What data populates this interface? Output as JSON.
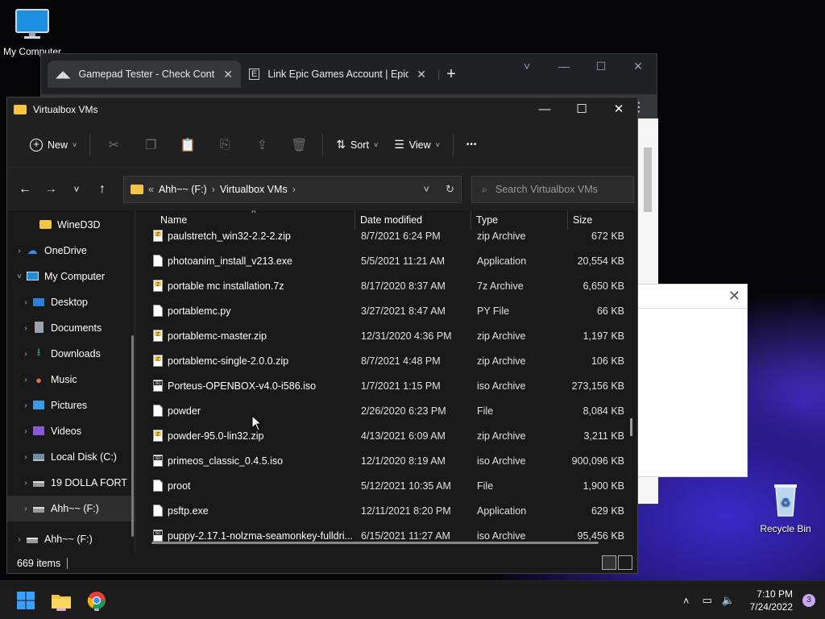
{
  "desktop": {
    "icons": [
      {
        "label": "My Computer",
        "icon": "monitor-icon"
      },
      {
        "label": "Recycle Bin",
        "icon": "recycle-bin-icon"
      }
    ]
  },
  "chrome": {
    "tabs": [
      {
        "title": "Gamepad Tester - Check Controll",
        "icon": "gamepad-site-icon",
        "active": true
      },
      {
        "title": "Link Epic Games Account | Epic G",
        "icon": "epic-games-icon",
        "active": false
      }
    ],
    "new_tab": "+",
    "controls": [
      "˅",
      "—",
      "☐",
      "✕"
    ]
  },
  "explorer": {
    "title": "Virtualbox VMs",
    "controls": [
      "—",
      "☐",
      "✕"
    ],
    "commands": {
      "new": "New",
      "sort": "Sort",
      "view": "View",
      "more": "•••"
    },
    "address": {
      "overflow": "«",
      "segments": [
        "Ahh~~ (F:)",
        "Virtualbox VMs"
      ],
      "sep": "›"
    },
    "search_placeholder": "Search Virtualbox VMs",
    "nav": [
      {
        "label": "WineD3D",
        "type": "folder",
        "indent": 1,
        "arrow": ""
      },
      {
        "label": "OneDrive",
        "type": "cloud",
        "indent": 0,
        "arrow": "›"
      },
      {
        "label": "My Computer",
        "type": "pc",
        "indent": 0,
        "arrow": "˅"
      },
      {
        "label": "Desktop",
        "type": "desktop",
        "indent": 1,
        "arrow": "›"
      },
      {
        "label": "Documents",
        "type": "docs",
        "indent": 1,
        "arrow": "›"
      },
      {
        "label": "Downloads",
        "type": "downloads",
        "indent": 1,
        "arrow": "›"
      },
      {
        "label": "Music",
        "type": "music",
        "indent": 1,
        "arrow": "›"
      },
      {
        "label": "Pictures",
        "type": "pictures",
        "indent": 1,
        "arrow": "›"
      },
      {
        "label": "Videos",
        "type": "videos",
        "indent": 1,
        "arrow": "›"
      },
      {
        "label": "Local Disk (C:)",
        "type": "disk",
        "indent": 1,
        "arrow": "›"
      },
      {
        "label": "19 DOLLA FORT",
        "type": "drive",
        "indent": 1,
        "arrow": "›"
      },
      {
        "label": "Ahh~~ (F:)",
        "type": "drive",
        "indent": 1,
        "arrow": "›",
        "selected": true
      },
      {
        "label": "Ahh~~ (F:)",
        "type": "drive",
        "indent": 0,
        "arrow": "›"
      }
    ],
    "columns": {
      "name": "Name",
      "date": "Date modified",
      "type": "Type",
      "size": "Size"
    },
    "files": [
      {
        "name": "paulstretch_win32-2.2-2.zip",
        "date": "8/7/2021 6:24 PM",
        "type": "zip Archive",
        "size": "672 KB",
        "kind": "zip"
      },
      {
        "name": "photoanim_install_v213.exe",
        "date": "5/5/2021 11:21 AM",
        "type": "Application",
        "size": "20,554 KB",
        "kind": "file"
      },
      {
        "name": "portable mc installation.7z",
        "date": "8/17/2020 8:37 AM",
        "type": "7z Archive",
        "size": "6,650 KB",
        "kind": "zip"
      },
      {
        "name": "portablemc.py",
        "date": "3/27/2021 8:47 AM",
        "type": "PY File",
        "size": "66 KB",
        "kind": "file"
      },
      {
        "name": "portablemc-master.zip",
        "date": "12/31/2020 4:36 PM",
        "type": "zip Archive",
        "size": "1,197 KB",
        "kind": "zip"
      },
      {
        "name": "portablemc-single-2.0.0.zip",
        "date": "8/7/2021 4:48 PM",
        "type": "zip Archive",
        "size": "106 KB",
        "kind": "zip"
      },
      {
        "name": "Porteus-OPENBOX-v4.0-i586.iso",
        "date": "1/7/2021 1:15 PM",
        "type": "iso Archive",
        "size": "273,156 KB",
        "kind": "iso"
      },
      {
        "name": "powder",
        "date": "2/26/2020 6:23 PM",
        "type": "File",
        "size": "8,084 KB",
        "kind": "file"
      },
      {
        "name": "powder-95.0-lin32.zip",
        "date": "4/13/2021 6:09 AM",
        "type": "zip Archive",
        "size": "3,211 KB",
        "kind": "zip"
      },
      {
        "name": "primeos_classic_0.4.5.iso",
        "date": "12/1/2020 8:19 AM",
        "type": "iso Archive",
        "size": "900,096 KB",
        "kind": "iso"
      },
      {
        "name": "proot",
        "date": "5/12/2021 10:35 AM",
        "type": "File",
        "size": "1,900 KB",
        "kind": "file"
      },
      {
        "name": "psftp.exe",
        "date": "12/11/2021 8:20 PM",
        "type": "Application",
        "size": "629 KB",
        "kind": "file"
      },
      {
        "name": "puppy-2.17.1-nolzma-seamonkey-fulldri...",
        "date": "6/15/2021 11:27 AM",
        "type": "iso Archive",
        "size": "95,456 KB",
        "kind": "iso"
      }
    ],
    "status": "669 items"
  },
  "taskbar": {
    "apps": [
      "windows-start-icon",
      "file-explorer-icon",
      "chrome-icon"
    ],
    "clock_time": "7:10 PM",
    "clock_date": "7/24/2022",
    "notifications": "3"
  }
}
